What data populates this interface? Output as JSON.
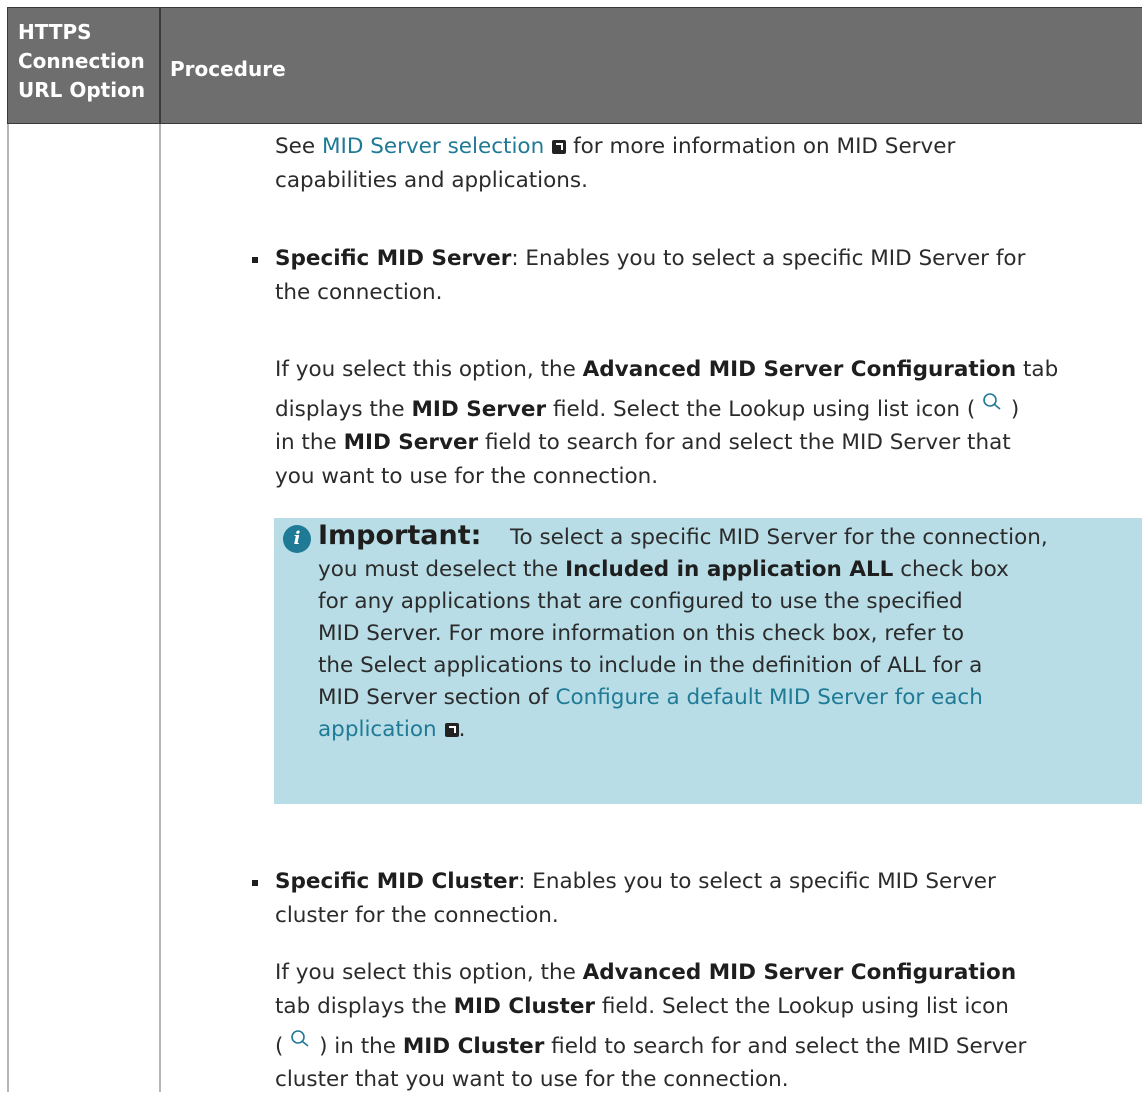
{
  "table_header": {
    "col1_lines": [
      "HTTPS",
      "Connection",
      "URL Option"
    ],
    "col2": "Procedure"
  },
  "intro": {
    "see": "See",
    "link": "MID Server selection",
    "rest1": "for more information on MID Server",
    "rest2": "capabilities and applications."
  },
  "specific_server": {
    "term": "Specific MID Server",
    "desc1": ": Enables you to select a specific MID Server for",
    "desc2": "the connection.",
    "p1": "If you select this option, the",
    "b1": "Advanced MID Server Configuration",
    "p2": "tab",
    "p3": "displays the",
    "b2": "MID Server",
    "p4": "field. Select the Lookup using list icon (",
    "p5": ")",
    "p6": "in the",
    "b3": "MID Server",
    "p7": "field to search for and select the MID Server that",
    "p8": "you want to use for the connection."
  },
  "note": {
    "icon": "i",
    "title": "Important:",
    "first": "To select a specific MID Server for the connection,",
    "l2a": "you must deselect the",
    "l2b": "Included in application ALL",
    "l2c": "check box",
    "l3": "for any applications that are configured to use the specified",
    "l4": "MID Server. For more information on this check box, refer to",
    "l5": "the Select applications to include in the definition of ALL for a",
    "l6": "MID Server section of",
    "link1": "Configure a default MID Server for each",
    "link2": "application",
    "end": "."
  },
  "specific_cluster": {
    "term": "Specific MID Cluster",
    "desc1": ": Enables you to select a specific MID Server",
    "desc2": "cluster for the connection.",
    "p1": "If you select this option, the",
    "b1": "Advanced MID Server Configuration",
    "p2": "tab displays the",
    "b2": "MID Cluster",
    "p3": "field. Select the Lookup using list icon",
    "p4": "(",
    "p5": ") in the",
    "b3": "MID Cluster",
    "p6": "field to search for and select the MID Server",
    "p7": "cluster that you want to use for the connection."
  },
  "colors": {
    "header_bg": "#6e6e6e",
    "note_bg": "#b8dde6",
    "link": "#1f7a96"
  },
  "icons": [
    "external-link-icon",
    "search-icon",
    "info-icon",
    "bullet-icon"
  ]
}
